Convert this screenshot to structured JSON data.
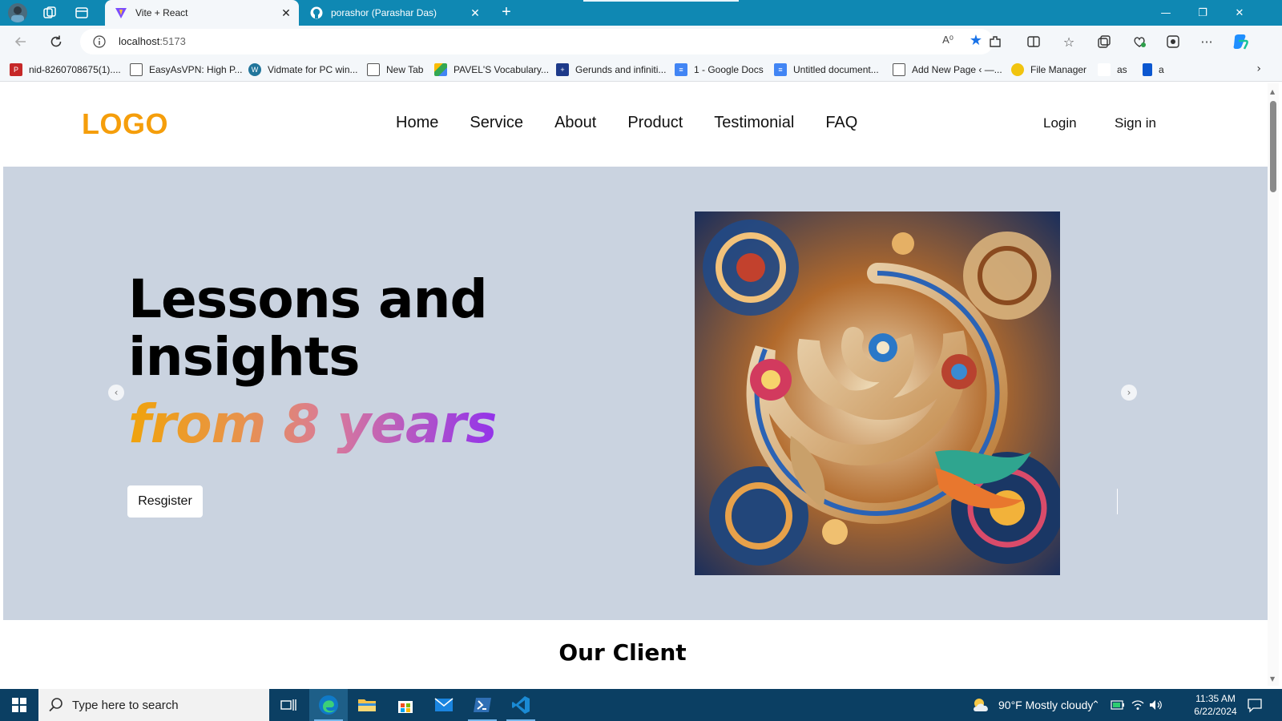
{
  "browser": {
    "tabs": [
      {
        "title": "Vite + React",
        "active": true
      },
      {
        "title": "porashor (Parashar Das)",
        "active": false
      }
    ],
    "new_tab": "+",
    "window_controls": {
      "minimize": "—",
      "restore": "❐",
      "close": "✕"
    },
    "address": {
      "host": "localhost",
      "port": ":5173"
    },
    "read_aloud": "A⁰"
  },
  "bookmarks": [
    {
      "label": "nid-8260708675(1)....",
      "icon": "pdf-icon",
      "color": "#c62828"
    },
    {
      "label": "EasyAsVPN: High P...",
      "icon": "page-icon",
      "color": "#ffffff"
    },
    {
      "label": "Vidmate for PC win...",
      "icon": "wordpress-icon",
      "color": "#21759b"
    },
    {
      "label": "New Tab",
      "icon": "page-icon",
      "color": "#ffffff"
    },
    {
      "label": "PAVEL'S Vocabulary...",
      "icon": "drive-icon",
      "color": "#fbbc04"
    },
    {
      "label": "Gerunds and infiniti...",
      "icon": "uk-flag-icon",
      "color": "#1e3a8a"
    },
    {
      "label": "1 - Google Docs",
      "icon": "docs-icon",
      "color": "#4285f4"
    },
    {
      "label": "Untitled document...",
      "icon": "docs-icon",
      "color": "#4285f4"
    },
    {
      "label": "Add New Page ‹ —...",
      "icon": "page-icon",
      "color": "#ffffff"
    },
    {
      "label": "File Manager",
      "icon": "file-manager-icon",
      "color": "#f1c40f"
    },
    {
      "label": "as",
      "icon": "blank-icon",
      "color": "#ffffff"
    },
    {
      "label": "a",
      "icon": "app-icon",
      "color": "#0b57d0"
    }
  ],
  "site": {
    "logo": "LOGO",
    "menu": [
      "Home",
      "Service",
      "About",
      "Product",
      "Testimonial",
      "FAQ"
    ],
    "login": "Login",
    "signin": "Sign in",
    "hero": {
      "headline_line1": "Lessons and",
      "headline_line2": "insights",
      "highlight": "from 8 years",
      "register_button": "Resgister",
      "prev_arrow": "‹",
      "next_arrow": "›"
    },
    "section_title": "Our Client"
  },
  "taskbar": {
    "search_placeholder": "Type here to search",
    "weather": "90°F  Mostly cloudy",
    "time": "11:35 AM",
    "date": "6/22/2024"
  },
  "colors": {
    "tabstrip": "#0f88b3",
    "logo": "#f59e0b",
    "hero_bg": "#cad3e0",
    "gradient_start": "#f0a30a",
    "gradient_end": "#9333ea",
    "taskbar": "#0b3f63"
  }
}
